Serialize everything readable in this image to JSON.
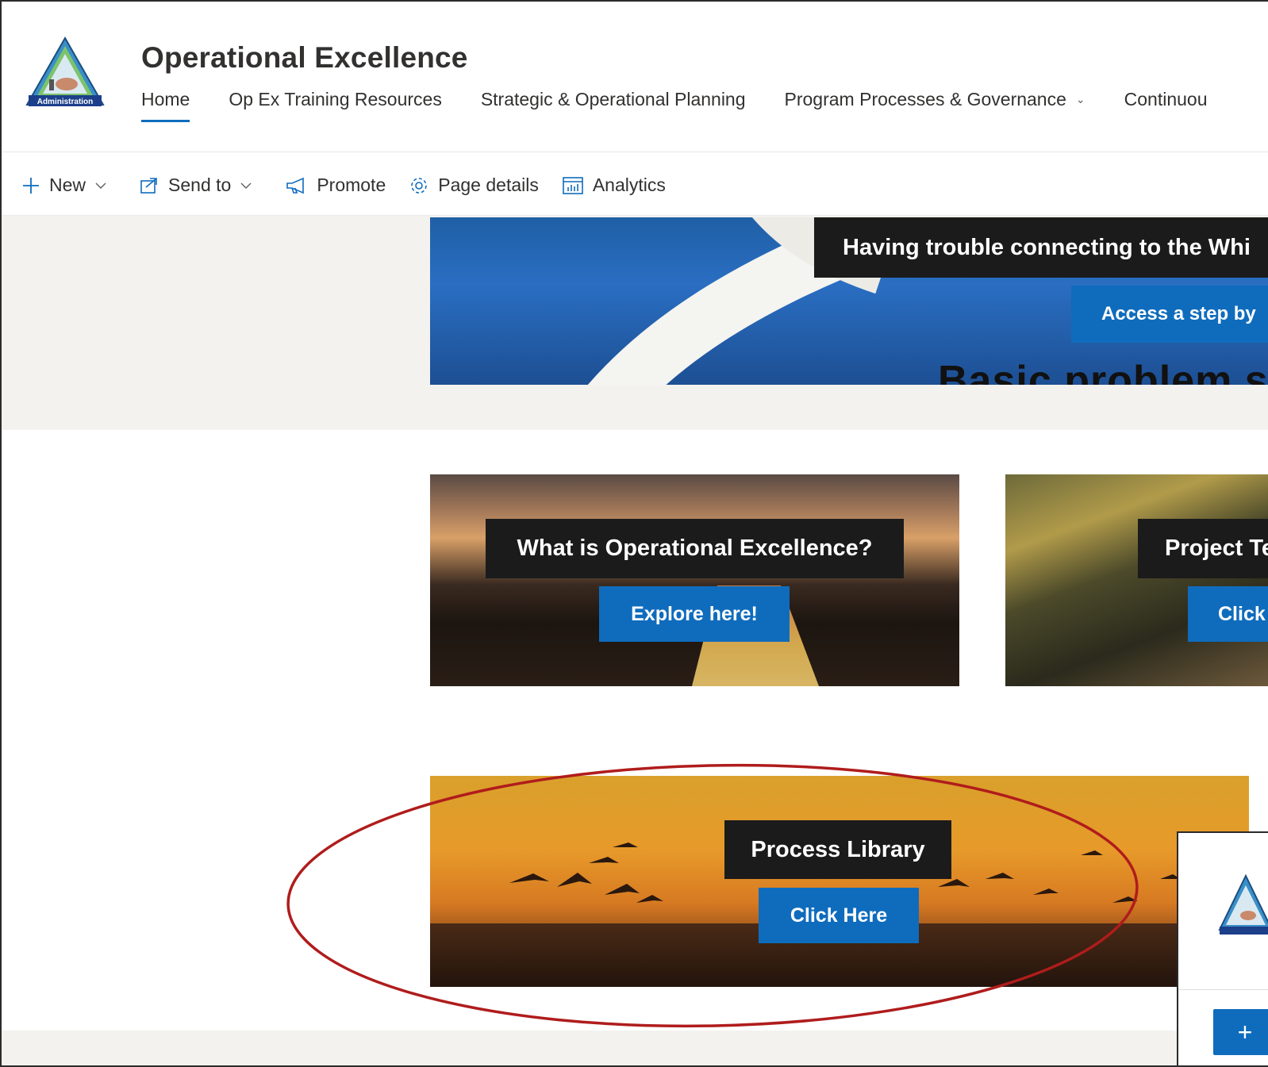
{
  "site": {
    "title": "Operational Excellence",
    "logo_icon": "agency-triangle-logo",
    "logo_text": "Administration"
  },
  "topnav": {
    "items": [
      {
        "label": "Home",
        "active": true
      },
      {
        "label": "Op Ex Training Resources"
      },
      {
        "label": "Strategic & Operational Planning"
      },
      {
        "label": "Program Processes & Governance",
        "has_dropdown": true
      },
      {
        "label": "Continuou"
      }
    ]
  },
  "commandbar": {
    "new_label": "New",
    "send_to_label": "Send to",
    "promote_label": "Promote",
    "page_details_label": "Page details",
    "analytics_label": "Analytics"
  },
  "hero": {
    "title": "Having trouble connecting to the Whi",
    "button": "Access a step by",
    "subtitle": "Basic problem s"
  },
  "tiles": [
    {
      "title": "What is Operational Excellence?",
      "button": "Explore here!"
    },
    {
      "title": "Project Te",
      "button": "Click"
    },
    {
      "title": "Process Library",
      "button": "Click Here"
    }
  ],
  "inset": {
    "add_button": "+"
  },
  "colors": {
    "accent": "#0f6cbd",
    "annotation": "#b01c1c",
    "band": "#f3f2ef"
  }
}
